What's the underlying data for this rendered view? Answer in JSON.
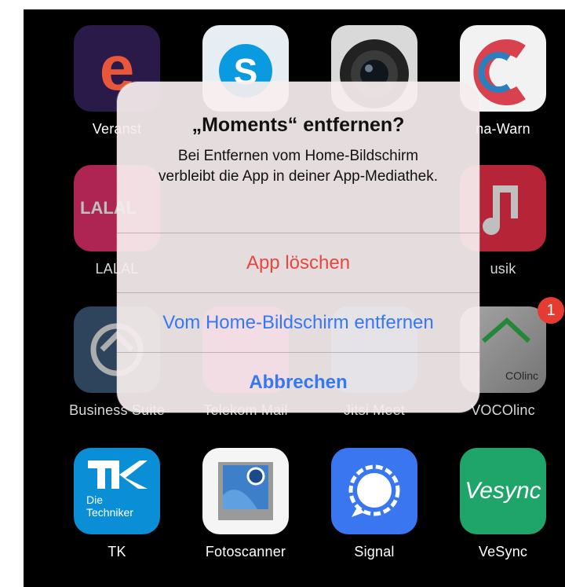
{
  "alert": {
    "title": "„Moments“ entfernen?",
    "message": "Bei Entfernen vom Home-Bildschirm verbleibt die App in deiner App-Mediathek.",
    "delete_label": "App löschen",
    "remove_label": "Vom Home-Bildschirm entfernen",
    "cancel_label": "Abbrechen"
  },
  "apps": {
    "r1c1": {
      "label": "Veranst",
      "icon": "veranstaltungen-e-icon"
    },
    "r1c2": {
      "label": "",
      "icon": "skype-icon"
    },
    "r1c3": {
      "label": "",
      "icon": "camera-lens-icon"
    },
    "r1c4": {
      "label": "na-Warn",
      "icon": "corona-warn-icon"
    },
    "r2c1": {
      "label": "LALAL",
      "icon_text": "LALAL",
      "icon": "lalal-icon"
    },
    "r2c4": {
      "label": "usik",
      "icon": "music-note-icon"
    },
    "r3c1": {
      "label": "Business Suite",
      "icon": "business-suite-icon"
    },
    "r3c2": {
      "label": "Telekom Mail",
      "icon": "telekom-mail-icon"
    },
    "r3c3": {
      "label": "Jitsi Meet",
      "icon": "jitsi-icon"
    },
    "r3c4": {
      "label": "VOCOlinc",
      "icon_text": "COlinc",
      "badge": "1",
      "icon": "vocolinc-home-icon"
    },
    "r4c1": {
      "label": "TK",
      "icon_line1": "Die",
      "icon_line2": "Techniker",
      "icon": "tk-icon"
    },
    "r4c2": {
      "label": "Fotoscanner",
      "icon": "photoscan-icon"
    },
    "r4c3": {
      "label": "Signal",
      "icon": "signal-chat-icon"
    },
    "r4c4": {
      "label": "VeSync",
      "icon_text": "Vesync",
      "icon": "vesync-icon"
    }
  },
  "colors": {
    "destructive": "#e8463e",
    "action": "#3478f6",
    "badge": "#e53b30"
  }
}
